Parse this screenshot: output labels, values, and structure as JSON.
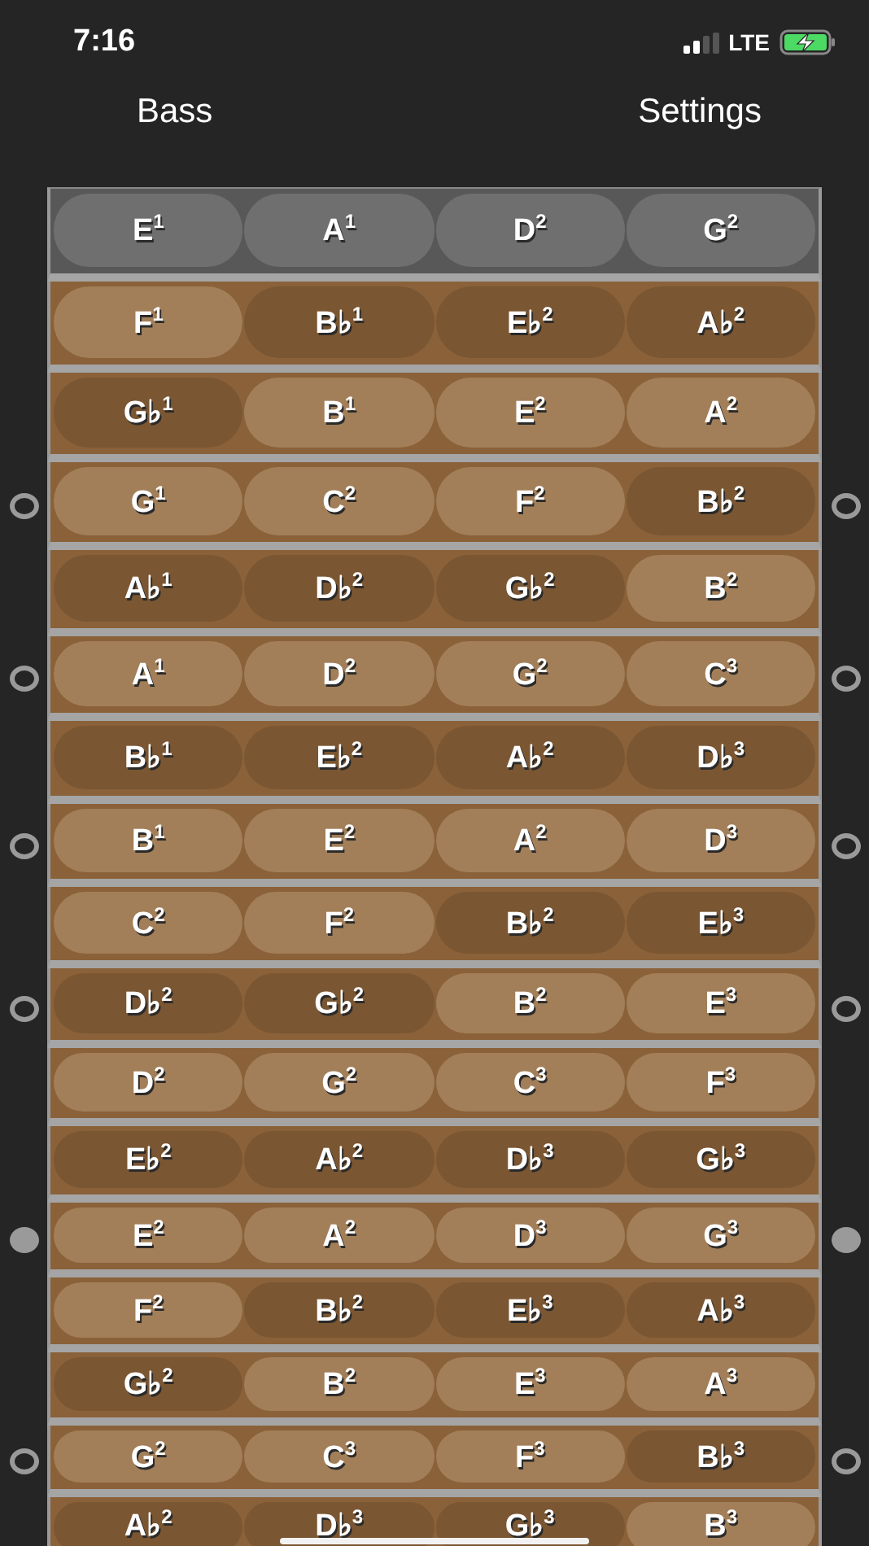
{
  "status_bar": {
    "time": "7:16",
    "network": "LTE"
  },
  "nav": {
    "left": "Bass",
    "right": "Settings"
  },
  "open_strings": [
    "E$^{1}$",
    "A$^{1}$",
    "D$^{2}$",
    "G$^{2}$"
  ],
  "rows": [
    {
      "notes": [
        {
          "note": "F$^{1}$",
          "highlighted": false
        },
        {
          "note": "B♭$^{1}$",
          "highlighted": true
        },
        {
          "note": "E♭$^{2}$",
          "highlighted": true
        },
        {
          "note": "A♭$^{2}$",
          "highlighted": true
        }
      ]
    },
    {
      "notes": [
        {
          "note": "G♭$^{1}$",
          "highlighted": true
        },
        {
          "note": "B$^{1}$",
          "highlighted": false
        },
        {
          "note": "E$^{2}$",
          "highlighted": false
        },
        {
          "note": "A$^{2}$",
          "highlighted": false
        }
      ]
    },
    {
      "inlay": {
        "filled": false
      },
      "notes": [
        {
          "note": "G$^{1}$",
          "highlighted": false
        },
        {
          "note": "C$^{2}$",
          "highlighted": false
        },
        {
          "note": "F$^{2}$",
          "highlighted": false
        },
        {
          "note": "B♭$^{2}$",
          "highlighted": true
        }
      ]
    },
    {
      "notes": [
        {
          "note": "A♭$^{1}$",
          "highlighted": true
        },
        {
          "note": "D♭$^{2}$",
          "highlighted": true
        },
        {
          "note": "G♭$^{2}$",
          "highlighted": true
        },
        {
          "note": "B$^{2}$",
          "highlighted": false
        }
      ]
    },
    {
      "inlay": {
        "filled": false
      },
      "notes": [
        {
          "note": "A$^{1}$",
          "highlighted": false
        },
        {
          "note": "D$^{2}$",
          "highlighted": false
        },
        {
          "note": "G$^{2}$",
          "highlighted": false
        },
        {
          "note": "C$^{3}$",
          "highlighted": false
        }
      ]
    },
    {
      "notes": [
        {
          "note": "B♭$^{1}$",
          "highlighted": true
        },
        {
          "note": "E♭$^{2}$",
          "highlighted": true
        },
        {
          "note": "A♭$^{2}$",
          "highlighted": true
        },
        {
          "note": "D♭$^{3}$",
          "highlighted": true
        }
      ]
    },
    {
      "inlay": {
        "filled": false
      },
      "notes": [
        {
          "note": "B$^{1}$",
          "highlighted": false
        },
        {
          "note": "E$^{2}$",
          "highlighted": false
        },
        {
          "note": "A$^{2}$",
          "highlighted": false
        },
        {
          "note": "D$^{3}$",
          "highlighted": false
        }
      ]
    },
    {
      "notes": [
        {
          "note": "C$^{2}$",
          "highlighted": false
        },
        {
          "note": "F$^{2}$",
          "highlighted": false
        },
        {
          "note": "B♭$^{2}$",
          "highlighted": true
        },
        {
          "note": "E♭$^{3}$",
          "highlighted": true
        }
      ]
    },
    {
      "inlay": {
        "filled": false
      },
      "notes": [
        {
          "note": "D♭$^{2}$",
          "highlighted": true
        },
        {
          "note": "G♭$^{2}$",
          "highlighted": true
        },
        {
          "note": "B$^{2}$",
          "highlighted": false
        },
        {
          "note": "E$^{3}$",
          "highlighted": false
        }
      ]
    },
    {
      "notes": [
        {
          "note": "D$^{2}$",
          "highlighted": false
        },
        {
          "note": "G$^{2}$",
          "highlighted": false
        },
        {
          "note": "C$^{3}$",
          "highlighted": false
        },
        {
          "note": "F$^{3}$",
          "highlighted": false
        }
      ]
    },
    {
      "notes": [
        {
          "note": "E♭$^{2}$",
          "highlighted": true
        },
        {
          "note": "A♭$^{2}$",
          "highlighted": true
        },
        {
          "note": "D♭$^{3}$",
          "highlighted": true
        },
        {
          "note": "G♭$^{3}$",
          "highlighted": true
        }
      ]
    },
    {
      "inlay": {
        "filled": true
      },
      "notes": [
        {
          "note": "E$^{2}$",
          "highlighted": false
        },
        {
          "note": "A$^{2}$",
          "highlighted": false
        },
        {
          "note": "D$^{3}$",
          "highlighted": false
        },
        {
          "note": "G$^{3}$",
          "highlighted": false
        }
      ]
    },
    {
      "notes": [
        {
          "note": "F$^{2}$",
          "highlighted": false
        },
        {
          "note": "B♭$^{2}$",
          "highlighted": true
        },
        {
          "note": "E♭$^{3}$",
          "highlighted": true
        },
        {
          "note": "A♭$^{3}$",
          "highlighted": true
        }
      ]
    },
    {
      "notes": [
        {
          "note": "G♭$^{2}$",
          "highlighted": true
        },
        {
          "note": "B$^{2}$",
          "highlighted": false
        },
        {
          "note": "E$^{3}$",
          "highlighted": false
        },
        {
          "note": "A$^{3}$",
          "highlighted": false
        }
      ]
    },
    {
      "inlay": {
        "filled": false
      },
      "notes": [
        {
          "note": "G$^{2}$",
          "highlighted": false
        },
        {
          "note": "C$^{3}$",
          "highlighted": false
        },
        {
          "note": "F$^{3}$",
          "highlighted": false
        },
        {
          "note": "B♭$^{3}$",
          "highlighted": true
        }
      ]
    },
    {
      "notes": [
        {
          "note": "A♭$^{2}$",
          "highlighted": true
        },
        {
          "note": "D♭$^{3}$",
          "highlighted": true
        },
        {
          "note": "G♭$^{3}$",
          "highlighted": true
        },
        {
          "note": "B$^{3}$",
          "highlighted": false
        }
      ]
    }
  ]
}
